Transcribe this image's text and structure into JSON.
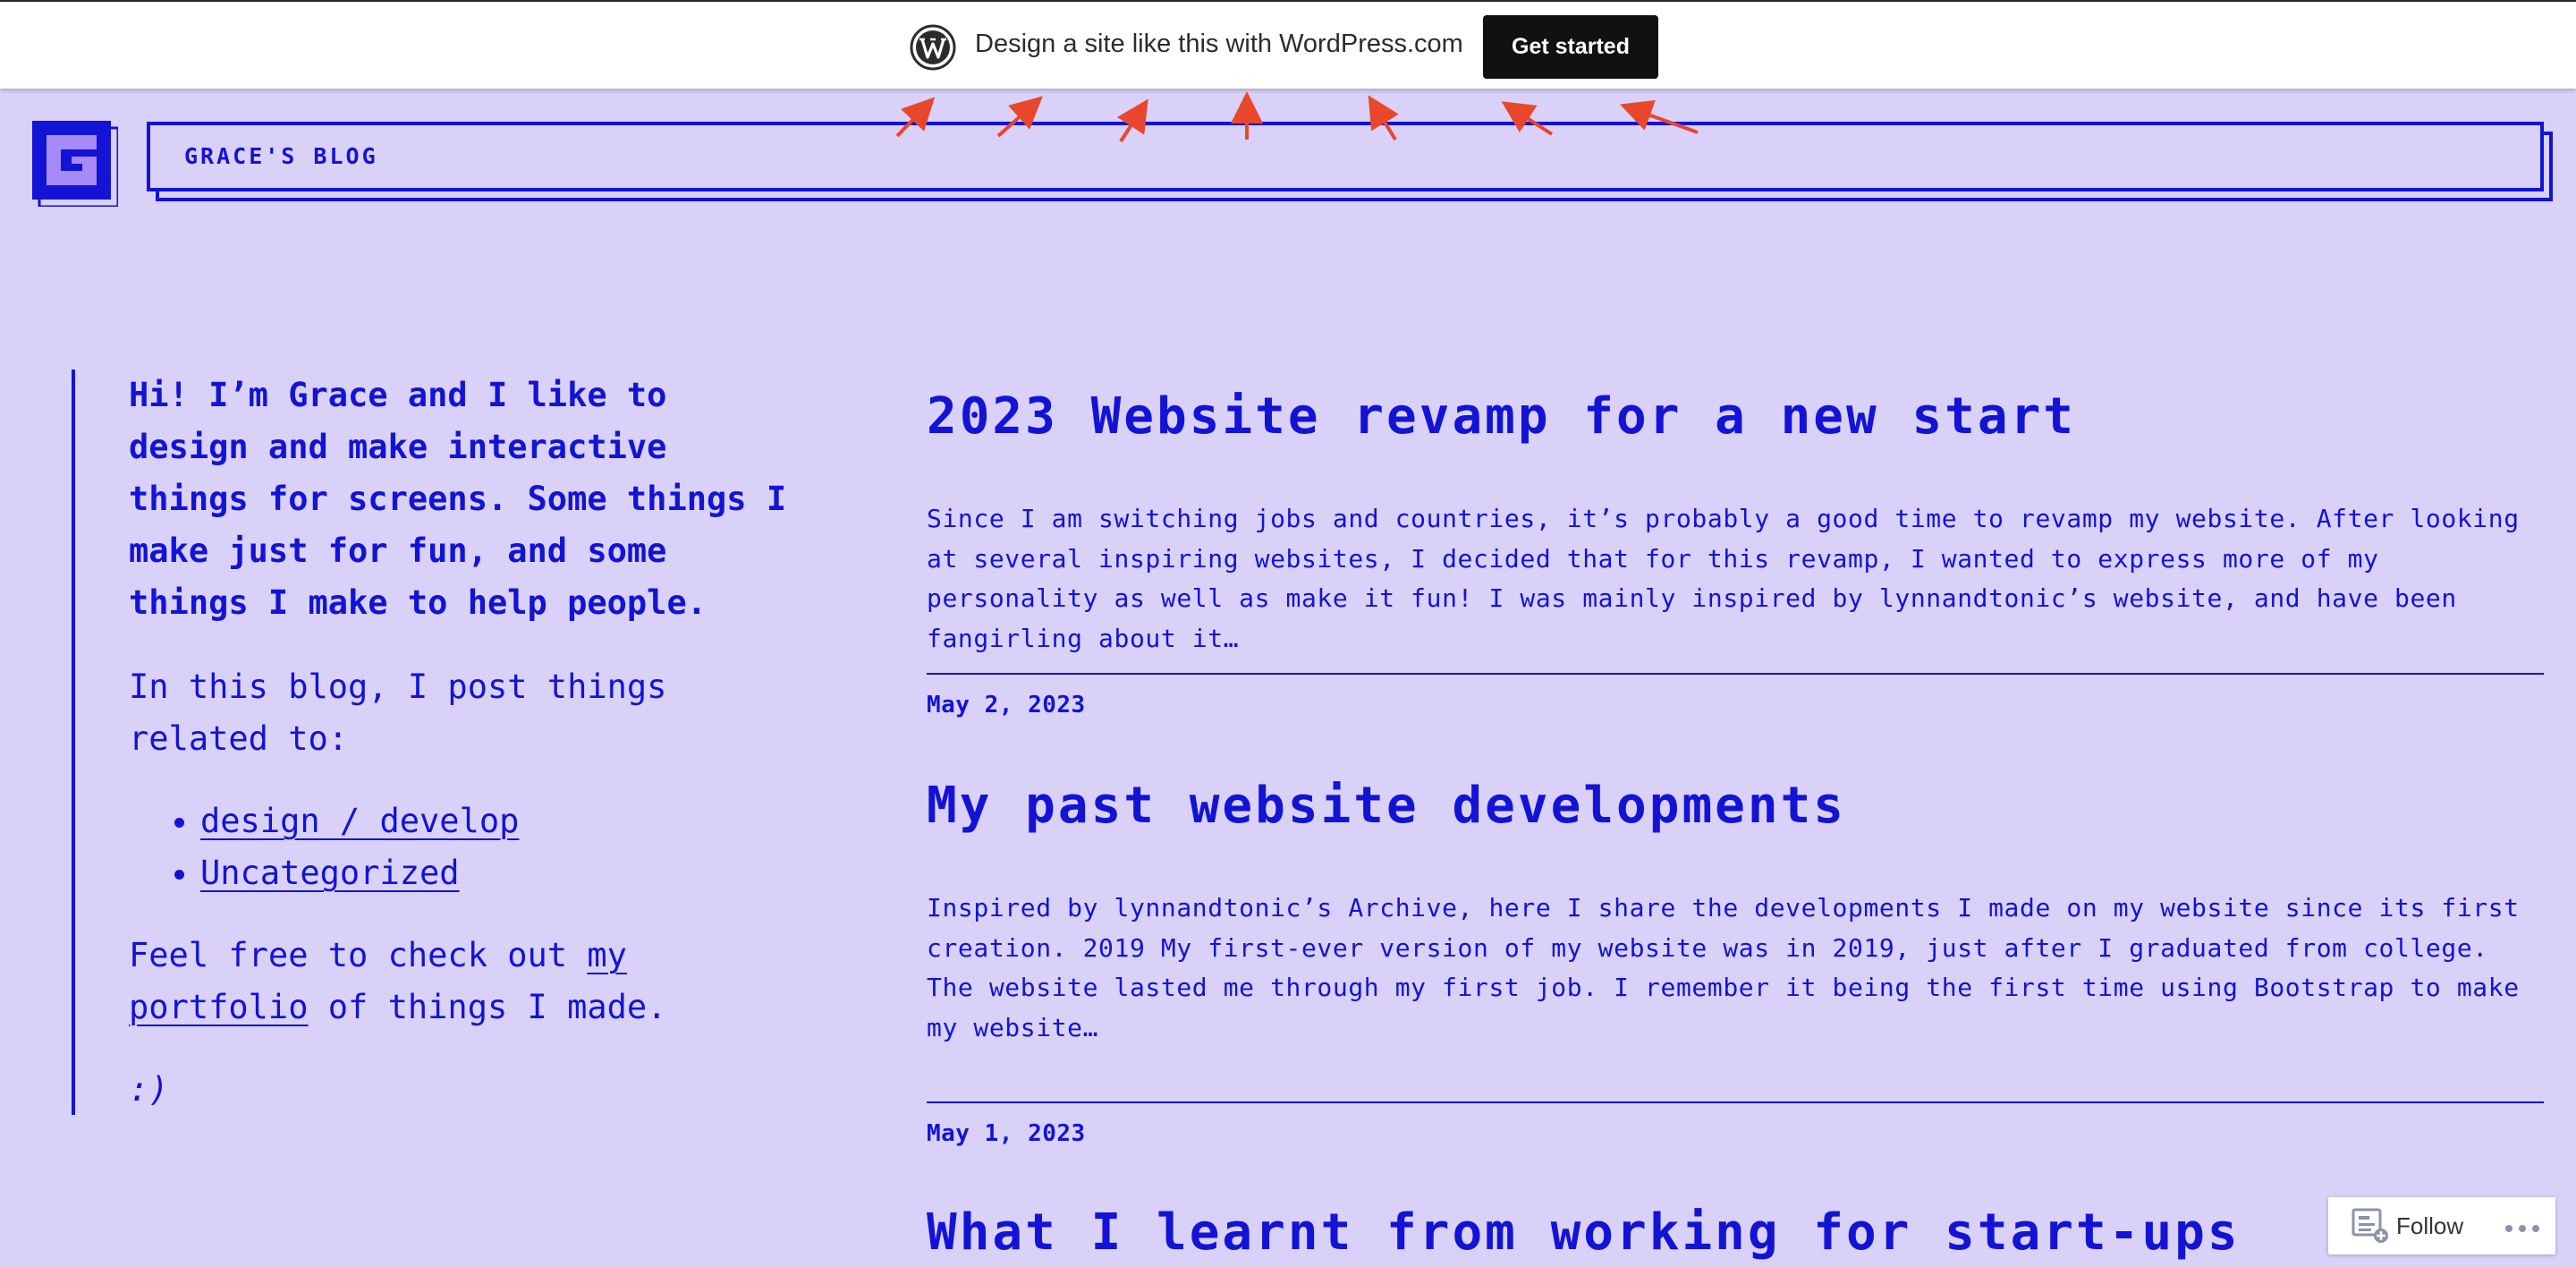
{
  "wp_banner": {
    "text": "Design a site like this with WordPress.com",
    "button_label": "Get started",
    "icon": "wordpress-logo-icon"
  },
  "site": {
    "title": "GRACE'S BLOG",
    "logo_letter": "G"
  },
  "sidebar": {
    "intro": "Hi! I’m Grace and I like to design and make interactive things for screens. Some things I make just for fun, and some things I make to help people.",
    "blog_intro": "In this blog, I post things related to:",
    "categories": [
      "design / develop",
      "Uncategorized"
    ],
    "portfolio_prefix": "Feel free to check out ",
    "portfolio_link": "my portfolio",
    "portfolio_suffix": " of things I made.",
    "smile": ":)"
  },
  "posts": [
    {
      "title": "2023 Website revamp for a new start",
      "excerpt": "Since I am switching jobs and countries, it’s probably a good time to revamp my website. After looking at several inspiring websites, I decided that for this revamp, I wanted to express more of my personality as well as make it fun! I was mainly inspired by lynnandtonic’s website, and have been fangirling about it…",
      "date": "May 2, 2023"
    },
    {
      "title": "My past website developments",
      "excerpt": "Inspired by lynnandtonic’s Archive, here I share the developments I made on my website since its first creation. 2019 My first-ever version of my website was in 2019, just after I graduated from college. The website lasted me through my first job. I remember it being the first time using Bootstrap to make my website…",
      "date": "May 1, 2023"
    },
    {
      "title": "What I learnt from working for start-ups"
    }
  ],
  "follow_widget": {
    "label": "Follow",
    "icon": "follow-reader-icon",
    "more_icon": "more-options-icon"
  },
  "colors": {
    "background": "#d9d1f7",
    "accent": "#1313d6",
    "annotation": "#e8472c"
  }
}
